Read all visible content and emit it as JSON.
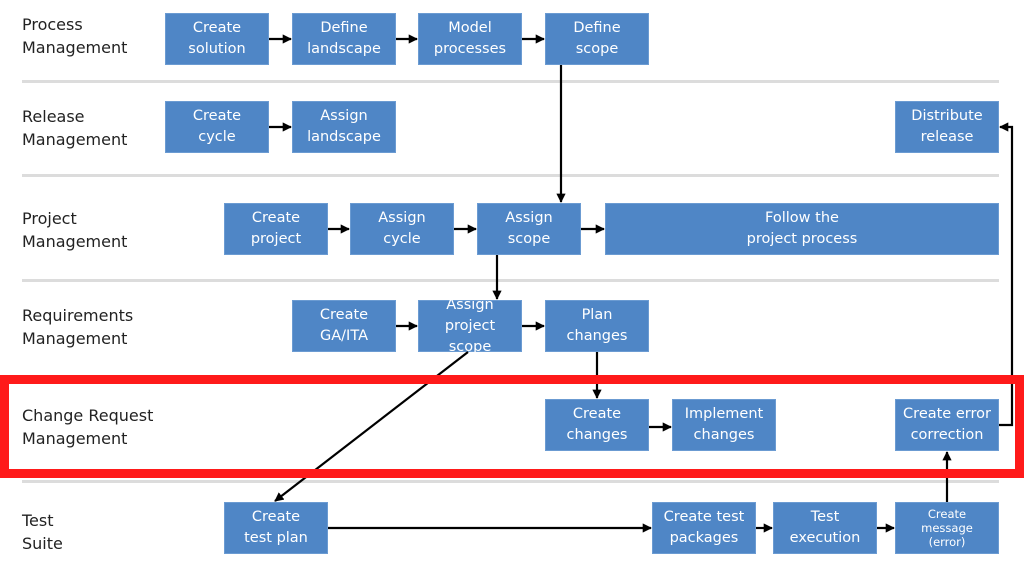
{
  "lanes": [
    {
      "id": "process",
      "label": "Process\nManagement"
    },
    {
      "id": "release",
      "label": "Release\nManagement"
    },
    {
      "id": "project",
      "label": "Project\nManagement"
    },
    {
      "id": "requirements",
      "label": "Requirements\nManagement"
    },
    {
      "id": "change",
      "label": "Change Request\nManagement"
    },
    {
      "id": "test",
      "label": "Test\nSuite"
    }
  ],
  "steps": {
    "create_solution": "Create\nsolution",
    "define_landscape": "Define\nlandscape",
    "model_processes": "Model\nprocesses",
    "define_scope": "Define\nscope",
    "create_cycle": "Create\ncycle",
    "assign_landscape": "Assign\nlandscape",
    "distribute_release": "Distribute\nrelease",
    "create_project": "Create\nproject",
    "assign_cycle": "Assign\ncycle",
    "assign_scope": "Assign\nscope",
    "follow_project_process": "Follow the\nproject process",
    "create_ga_ita": "Create\nGA/ITA",
    "assign_project_scope": "Assign project\nscope",
    "plan_changes": "Plan\nchanges",
    "create_changes": "Create\nchanges",
    "implement_changes": "Implement\nchanges",
    "create_error_correction": "Create error\ncorrection",
    "create_test_plan": "Create\ntest plan",
    "create_test_packages": "Create test\npackages",
    "test_execution": "Test\nexecution",
    "create_message_error": "Create\nmessage\n(error)"
  },
  "highlight": {
    "lane": "change",
    "color": "#ff1a1a"
  },
  "colors": {
    "box": "#4f86c6",
    "separator": "#dcdcdc",
    "arrow": "#000000"
  }
}
